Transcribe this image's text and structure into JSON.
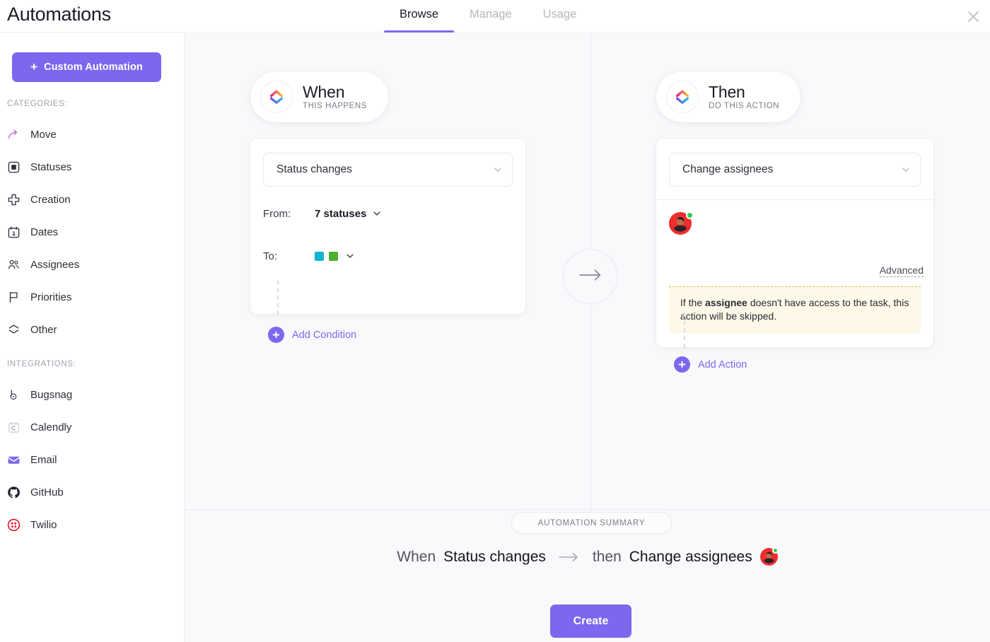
{
  "header": {
    "title": "Automations",
    "tabs": [
      {
        "label": "Browse",
        "active": true
      },
      {
        "label": "Manage",
        "active": false
      },
      {
        "label": "Usage",
        "active": false
      }
    ],
    "close_icon": "close-icon"
  },
  "sidebar": {
    "custom_automation_label": "Custom Automation",
    "custom_automation_plus": "+",
    "categories_heading": "CATEGORIES:",
    "categories": [
      {
        "label": "Move",
        "icon": "move-arrow-icon"
      },
      {
        "label": "Statuses",
        "icon": "status-square-icon"
      },
      {
        "label": "Creation",
        "icon": "plus-cross-icon"
      },
      {
        "label": "Dates",
        "icon": "calendar-icon"
      },
      {
        "label": "Assignees",
        "icon": "people-icon"
      },
      {
        "label": "Priorities",
        "icon": "flag-icon"
      },
      {
        "label": "Other",
        "icon": "layers-icon"
      }
    ],
    "integrations_heading": "INTEGRATIONS:",
    "integrations": [
      {
        "label": "Bugsnag",
        "icon": "bugsnag-icon"
      },
      {
        "label": "Calendly",
        "icon": "calendly-icon"
      },
      {
        "label": "Email",
        "icon": "email-envelope-icon"
      },
      {
        "label": "GitHub",
        "icon": "github-icon"
      },
      {
        "label": "Twilio",
        "icon": "twilio-icon"
      }
    ]
  },
  "trigger": {
    "pill_title": "When",
    "pill_subtitle": "THIS HAPPENS",
    "logo_icon": "clickup-logo-icon",
    "select_value": "Status changes",
    "chevron_icon": "chevron-down-icon",
    "from_label": "From:",
    "from_value": "7 statuses",
    "to_label": "To:",
    "to_statuses": [
      {
        "name": "status-swatch-cyan",
        "color": "#10b2d4"
      },
      {
        "name": "status-swatch-green",
        "color": "#4caf2f"
      }
    ],
    "add_condition_label": "Add Condition"
  },
  "action": {
    "pill_title": "Then",
    "pill_subtitle": "DO THIS ACTION",
    "logo_icon": "clickup-logo-icon",
    "select_value": "Change assignees",
    "chevron_icon": "chevron-down-icon",
    "assignee_avatar": "assignee-avatar",
    "assignee_status_color": "#2ecc5b",
    "advanced_label": "Advanced",
    "warning_prefix": "If the ",
    "warning_bold": "assignee",
    "warning_suffix": " doesn't have access to the task, this action will be skipped.",
    "add_action_label": "Add Action"
  },
  "flow": {
    "arrow_icon": "arrow-right-icon"
  },
  "summary": {
    "pill_label": "AUTOMATION SUMMARY",
    "when_word": "When",
    "trigger_name": "Status changes",
    "arrow_icon": "arrow-right-icon",
    "then_word": "then",
    "action_name": "Change assignees",
    "create_label": "Create"
  },
  "colors": {
    "accent": "#7b68ee",
    "canvas": "#f8f9fb",
    "warning_bg": "#fdf8e7",
    "warning_border": "#e2b84a"
  }
}
